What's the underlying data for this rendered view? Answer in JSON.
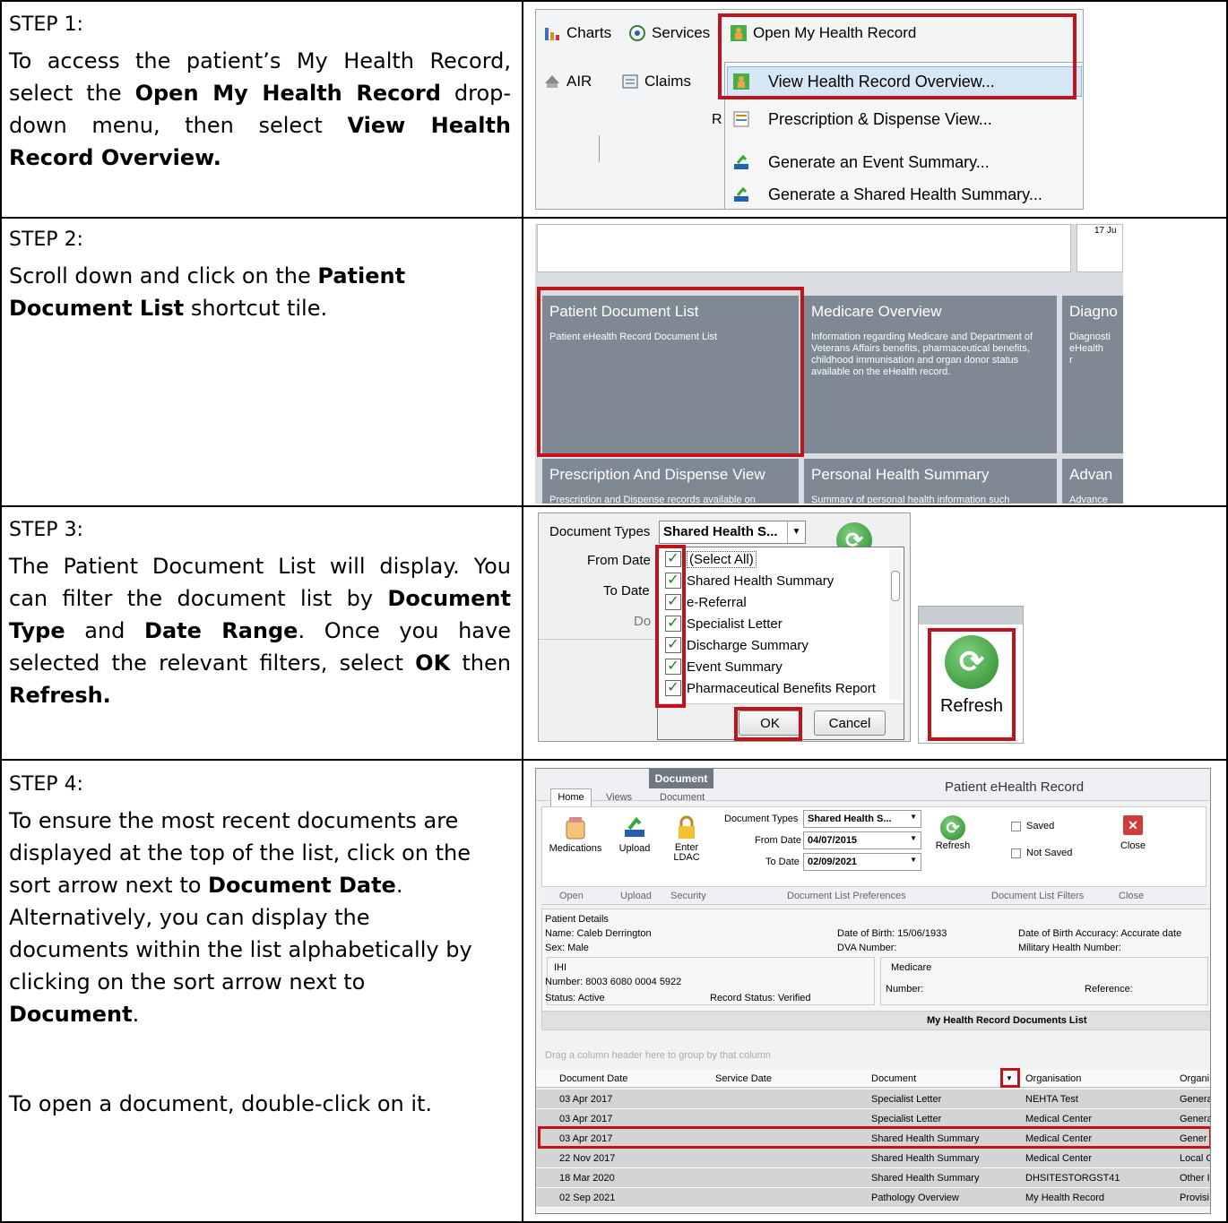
{
  "steps": [
    {
      "label": "STEP 1:",
      "t1": "To access the patient’s My Health Record, select the ",
      "b1": "Open My Health Record",
      "t2": " drop-down menu, then select ",
      "b2": "View Health Record Overview."
    },
    {
      "label": "STEP 2:",
      "t1": "Scroll down and click on the ",
      "b1": "Patient Document List",
      "t2": " shortcut tile."
    },
    {
      "label": "STEP 3:",
      "t1": "The Patient Document List will display. You can filter the document list by ",
      "b1": "Document Type",
      "t2": " and ",
      "b2": "Date Range",
      "t3": ". Once you have selected the relevant filters, select ",
      "b3": "OK",
      "t4": " then ",
      "b4": "Refresh."
    },
    {
      "label": "STEP 4:",
      "t1": "To ensure the most recent documents are displayed at the top of the list, click on the sort arrow next to ",
      "b1": "Document Date",
      "t2": ". Alternatively, you can display the documents within the list alphabetically by clicking on the sort arrow next to ",
      "b2": "Document",
      "t3": ".",
      "t4": "To open a document, double-click on it."
    }
  ],
  "s1": {
    "charts": "Charts",
    "services": "Services",
    "open_mhr": "Open My Health Record",
    "air": "AIR",
    "claims": "Claims",
    "frag": "R",
    "menu": [
      "View Health Record Overview...",
      "Prescription & Dispense View...",
      "Generate an Event Summary...",
      "Generate a Shared Health Summary..."
    ]
  },
  "s2": {
    "date_frag": "17 Ju",
    "tiles": [
      {
        "title": "Patient Document List",
        "desc": "Patient eHealth Record Document List"
      },
      {
        "title": "Medicare Overview",
        "desc": "Information regarding Medicare and Department of Veterans Affairs benefits, pharmaceutical benefits, childhood immunisation and organ donor status available on the eHealth record."
      },
      {
        "title": "Diagno",
        "desc": "Diagnosti eHealth r"
      },
      {
        "title": "Prescription And Dispense View",
        "desc": "Prescription and Dispense records available on"
      },
      {
        "title": "Personal Health Summary",
        "desc": "Summary of personal health information such"
      },
      {
        "title": "Advan",
        "desc": "Advance"
      }
    ]
  },
  "s3": {
    "doc_types_label": "Document Types",
    "doc_types_value": "Shared Health S...",
    "from_date": "From Date",
    "to_date": "To Date",
    "doc_frag": "Do",
    "items": [
      "(Select All)",
      "Shared Health Summary",
      "e-Referral",
      "Specialist Letter",
      "Discharge Summary",
      "Event Summary",
      "Pharmaceutical Benefits Report"
    ],
    "check": "✓",
    "ok": "OK",
    "cancel": "Cancel",
    "refresh": "Refresh"
  },
  "s4": {
    "ctx_tab": "Document",
    "title": "Patient eHealth Record",
    "tabs": [
      "Home",
      "Views",
      "Document"
    ],
    "ribbon": {
      "medications": "Medications",
      "upload": "Upload",
      "enter_ldac": "Enter\nLDAC",
      "doc_types_label": "Document Types",
      "doc_types_value": "Shared Health S...",
      "from_date_label": "From Date",
      "from_date": "04/07/2015",
      "to_date_label": "To Date",
      "to_date": "02/09/2021",
      "refresh": "Refresh",
      "saved": "Saved",
      "not_saved": "Not Saved",
      "close": "Close",
      "groups": [
        "Open",
        "Upload",
        "Security",
        "Document List Preferences",
        "Document List Filters",
        "Close"
      ]
    },
    "patient": {
      "header": "Patient Details",
      "name": "Name:   Caleb Derrington",
      "sex": "Sex:     Male",
      "dob": "Date of Birth:  15/06/1933",
      "dva": "DVA Number:",
      "dob_acc": "Date of Birth Accuracy:  Accurate date",
      "military": "Military Health Number:",
      "ihi": "IHI",
      "number": "Number:   8003 6080 0004 5922",
      "status": "Status:    Active",
      "record_status": "Record Status:  Verified",
      "medicare": "Medicare",
      "med_number": "Number:",
      "reference": "Reference:"
    },
    "list_title": "My Health Record Documents List",
    "group_hint": "Drag a column header here to group by that column",
    "columns": [
      "Document Date",
      "Service Date",
      "Document",
      "Organisation",
      "Organi"
    ],
    "rows": [
      [
        "03 Apr 2017",
        "",
        "Specialist Letter",
        "NEHTA Test",
        "Genera"
      ],
      [
        "03 Apr 2017",
        "",
        "Specialist Letter",
        "Medical Center",
        "Genera"
      ],
      [
        "03 Apr 2017",
        "",
        "Shared Health Summary",
        "Medical Center",
        "Gener"
      ],
      [
        "22 Nov 2017",
        "",
        "Shared Health Summary",
        "Medical Center",
        "Local G"
      ],
      [
        "18 Mar 2020",
        "",
        "Shared Health Summary",
        "DHSITESTORGST41",
        "Other I"
      ],
      [
        "02 Sep 2021",
        "",
        "Pathology Overview",
        "My Health Record",
        "Provisi"
      ]
    ]
  },
  "colors": {
    "highlight": "#c0141c",
    "tile": "#7e8994"
  }
}
